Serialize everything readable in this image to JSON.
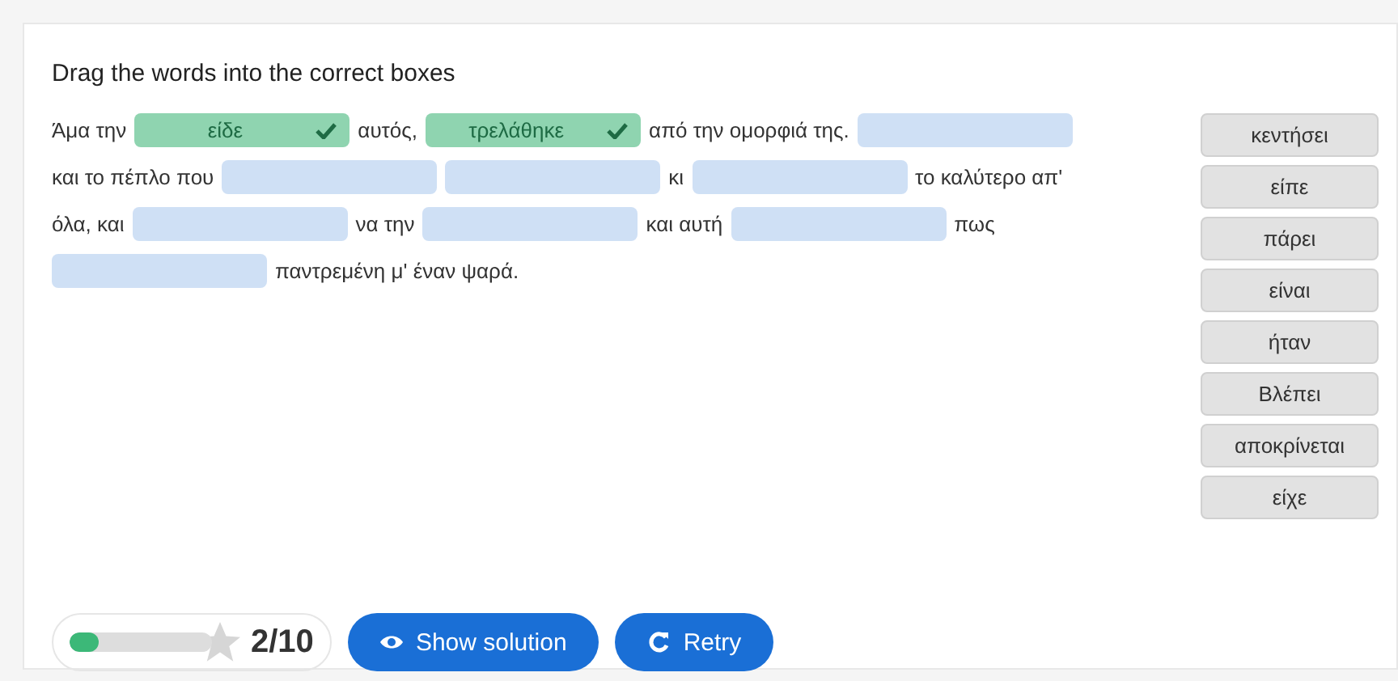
{
  "title": "Drag the words into the correct boxes",
  "lines": [
    [
      {
        "kind": "text",
        "text": "Άμα την"
      },
      {
        "kind": "filled",
        "text": "είδε",
        "correct": true
      },
      {
        "kind": "text",
        "text": "αυτός,"
      },
      {
        "kind": "filled",
        "text": "τρελάθηκε",
        "correct": true
      },
      {
        "kind": "text",
        "text": "από την ομορφιά της."
      },
      {
        "kind": "blank"
      }
    ],
    [
      {
        "kind": "text",
        "text": "και το πέπλο που"
      },
      {
        "kind": "blank"
      },
      {
        "kind": "blank"
      },
      {
        "kind": "text",
        "text": "κι"
      },
      {
        "kind": "blank"
      },
      {
        "kind": "text",
        "text": "το καλύτερο απ'"
      }
    ],
    [
      {
        "kind": "text",
        "text": "όλα, και"
      },
      {
        "kind": "blank"
      },
      {
        "kind": "text",
        "text": "να την"
      },
      {
        "kind": "blank"
      },
      {
        "kind": "text",
        "text": "και αυτή"
      },
      {
        "kind": "blank"
      },
      {
        "kind": "text",
        "text": "πως"
      }
    ],
    [
      {
        "kind": "blank"
      },
      {
        "kind": "text",
        "text": "παντρεμένη μ' έναν ψαρά."
      }
    ]
  ],
  "word_bank": [
    "κεντήσει",
    "είπε",
    "πάρει",
    "είναι",
    "ήταν",
    "Βλέπει",
    "αποκρίνεται",
    "είχε"
  ],
  "score": {
    "level": 0.2,
    "text": "2/10"
  },
  "buttons": [
    {
      "kind": "show",
      "label": "Show solution"
    },
    {
      "kind": "retry",
      "label": "Retry"
    }
  ]
}
